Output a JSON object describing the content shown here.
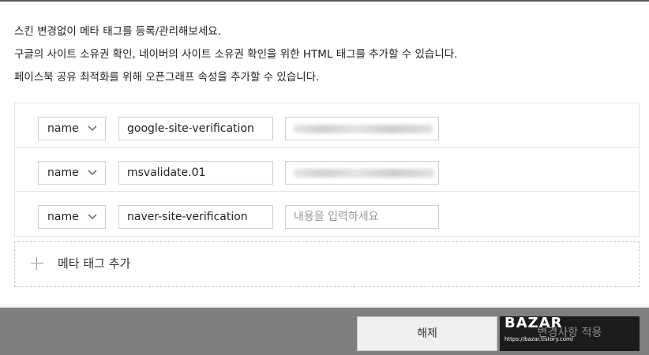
{
  "description": {
    "line1": "스킨 변경없이 메타 태그를 등록/관리해보세요.",
    "line2": "구글의 사이트 소유권 확인, 네이버의 사이트 소유권 확인을 위한 HTML 태그를 추가할 수 있습니다.",
    "line3": "페이스북 공유 최적화를 위해 오픈그래프 속성을 추가할 수 있습니다."
  },
  "meta_rows": [
    {
      "attr": "name",
      "key": "google-site-verification",
      "value": "",
      "value_blurred": true
    },
    {
      "attr": "name",
      "key": "msvalidate.01",
      "value": "",
      "value_blurred": true
    },
    {
      "attr": "name",
      "key": "naver-site-verification",
      "value": "",
      "placeholder": "내용을 입력하세요",
      "value_blurred": false
    }
  ],
  "add_meta_label": "메타 태그 추가",
  "footer": {
    "cancel_label": "해제",
    "apply_label": "변경사항 적용"
  },
  "watermark": {
    "title": "BAZAR",
    "url": "https://bazar.tistory.com/"
  },
  "icons": {
    "select_arrow": "chevron-down-icon",
    "add": "plus-icon"
  },
  "colors": {
    "footer_bg": "#7f7f7f",
    "apply_bg": "#1c1c1c",
    "border": "#cfcfcf"
  }
}
